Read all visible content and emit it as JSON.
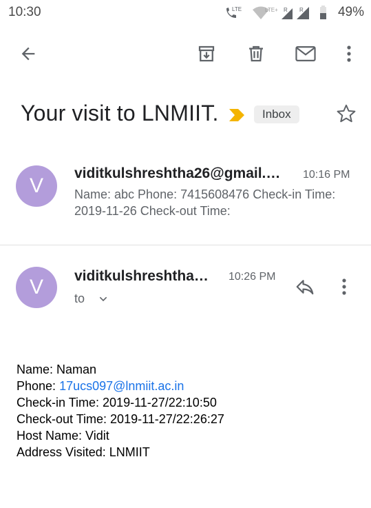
{
  "status_bar": {
    "time": "10:30",
    "lte_label": "LTE",
    "lte_plus_label": "LTE+",
    "roaming_label_1": "R",
    "roaming_label_2": "R",
    "battery_percent": "49%"
  },
  "toolbar": {
    "back_icon": "arrow-left-icon",
    "archive_icon": "archive-icon",
    "delete_icon": "trash-icon",
    "mark_unread_icon": "mail-icon",
    "more_icon": "more-vert-icon"
  },
  "email": {
    "subject": "Your visit to LNMIIT.",
    "label": "Inbox",
    "star_icon": "star-outline-icon",
    "importance_icon": "importance-marker-icon"
  },
  "messages": [
    {
      "avatar_letter": "V",
      "sender": "viditkulshreshtha26@gmail.…",
      "time": "10:16 PM",
      "snippet": "Name: abc Phone: 7415608476 Check-in Time: 2019-11-26 Check-out Time:"
    },
    {
      "avatar_letter": "V",
      "sender": "viditkulshreshtha…",
      "time": "10:26 PM",
      "to_label": "to",
      "body": {
        "name_line": "Name: Naman",
        "phone_prefix": "Phone: ",
        "phone_link": "17ucs097@lnmiit.ac.in",
        "checkin_line": "Check-in Time: 2019-11-27/22:10:50",
        "checkout_line": "Check-out Time: 2019-11-27/22:26:27",
        "host_line": "Host Name: Vidit",
        "address_line": "Address Visited: LNMIIT"
      }
    }
  ],
  "colors": {
    "avatar": "#b39ddb",
    "importance": "#f4b400",
    "link": "#1a73e8",
    "chip_bg": "#eeeeee"
  }
}
